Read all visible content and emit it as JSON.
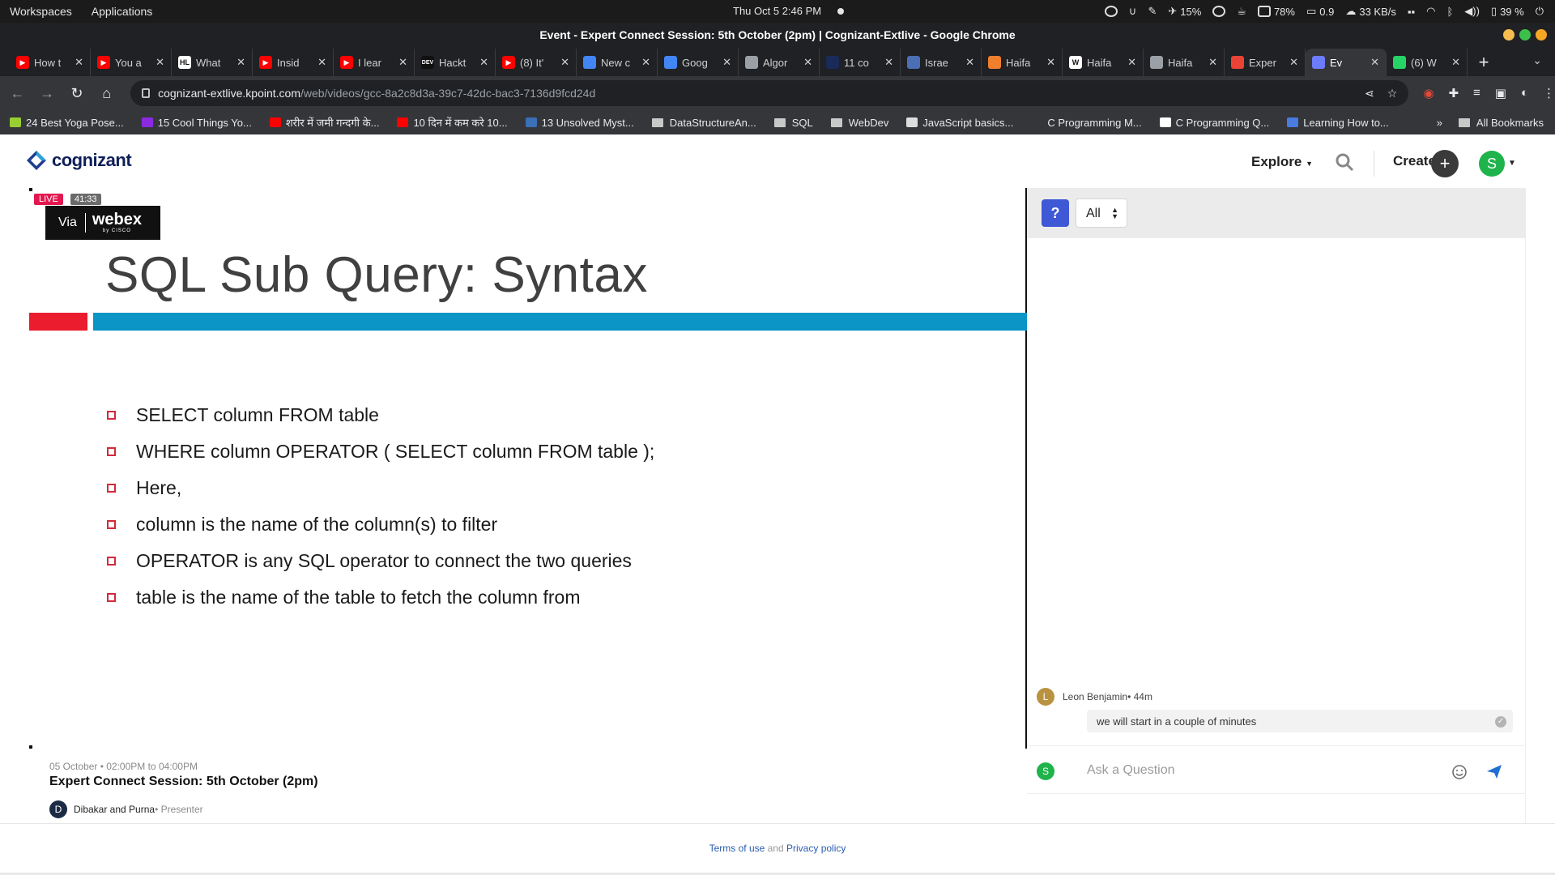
{
  "os": {
    "menus": [
      "Workspaces",
      "Applications"
    ],
    "clock": "Thu Oct 5   2:46 PM",
    "tray": {
      "fan": "15%",
      "battery_pct_label": "78%",
      "load": "0.9",
      "net": "33 KB/s",
      "power": "39 %"
    }
  },
  "window": {
    "title": "Event - Expert Connect Session: 5th October (2pm) | Cognizant-Extlive - Google Chrome"
  },
  "tabs": [
    {
      "label": "How t",
      "fav": "youtube",
      "color": "#ff0000"
    },
    {
      "label": "You a",
      "fav": "youtube",
      "color": "#ff0000"
    },
    {
      "label": "What",
      "fav": "HL",
      "color": "#ffffff"
    },
    {
      "label": "Insid",
      "fav": "youtube",
      "color": "#ff0000"
    },
    {
      "label": "I lear",
      "fav": "youtube",
      "color": "#ff0000"
    },
    {
      "label": "Hackt",
      "fav": "DEV",
      "color": "#111111"
    },
    {
      "label": "(8) It'",
      "fav": "youtube",
      "color": "#ff0000"
    },
    {
      "label": "New c",
      "fav": "gcloud",
      "color": "#4285f4"
    },
    {
      "label": "Goog",
      "fav": "gcloud",
      "color": "#4285f4"
    },
    {
      "label": "Algor",
      "fav": "globe",
      "color": "#9aa0a6"
    },
    {
      "label": "11 co",
      "fav": "R",
      "color": "#1a2a5a"
    },
    {
      "label": "Israe",
      "fav": "wiki",
      "color": "#4a6fb5"
    },
    {
      "label": "Haifa",
      "fav": "doc",
      "color": "#f07f2d"
    },
    {
      "label": "Haifa",
      "fav": "W",
      "color": "#ffffff"
    },
    {
      "label": "Haifa",
      "fav": "globe",
      "color": "#9aa0a6"
    },
    {
      "label": "Exper",
      "fav": "gmail",
      "color": "#ea4335"
    },
    {
      "label": "Ev",
      "fav": "kpoint",
      "color": "#6b7cff",
      "active": true
    },
    {
      "label": "(6) W",
      "fav": "whatsapp",
      "color": "#25d366"
    }
  ],
  "toolbar": {
    "url_host": "cognizant-extlive.kpoint.com",
    "url_path": "/web/videos/gcc-8a2c8d3a-39c7-42dc-bac3-7136d9fcd24d"
  },
  "bookmarks": [
    {
      "label": "24 Best Yoga Pose...",
      "color": "#9acd32"
    },
    {
      "label": "15 Cool Things Yo...",
      "color": "#8a2be2"
    },
    {
      "label": "शरीर में जमी गन्दगी के...",
      "color": "#ff0000"
    },
    {
      "label": "10 दिन में कम करे 10...",
      "color": "#ff0000"
    },
    {
      "label": "13 Unsolved Myst...",
      "color": "#3b6fb6"
    },
    {
      "label": "DataStructureAn...",
      "color": "folder"
    },
    {
      "label": "SQL",
      "color": "folder"
    },
    {
      "label": "WebDev",
      "color": "folder"
    },
    {
      "label": "JavaScript basics...",
      "color": "#dddddd"
    },
    {
      "label": "C Programming M...",
      "color": "#35363a"
    },
    {
      "label": "C Programming Q...",
      "color": "#ffffff"
    },
    {
      "label": "Learning How to...",
      "color": "#4a7be0"
    }
  ],
  "bookmarks_right": {
    "more": "»",
    "all": "All Bookmarks"
  },
  "site": {
    "logo_text": "cognizant",
    "explore": "Explore",
    "create": "Create",
    "create_plus": "+",
    "avatar_letter": "S"
  },
  "video": {
    "live": "LIVE",
    "elapsed": "41:33",
    "via": "Via",
    "webex": "webex",
    "cisco": "by CISCO",
    "slide_title": "SQL Sub Query: Syntax",
    "bullets": [
      "SELECT column FROM  table",
      "WHERE  column OPERATOR (  SELECT column FROM table );",
      "Here,",
      "column is the name of the column(s) to filter",
      "OPERATOR is any SQL operator to connect the two queries",
      "table is the name of the table to fetch the column from"
    ]
  },
  "event": {
    "date": "05 October • 02:00PM to 04:00PM",
    "title": "Expert Connect Session: 5th October (2pm)",
    "presenter_initial": "D",
    "presenter": "Dibakar and Purna",
    "presenter_role": " • Presenter"
  },
  "chat": {
    "question_icon": "?",
    "filter": "All",
    "message": {
      "initial": "L",
      "author": "Leon Benjamin",
      "time": " • 44m",
      "text": "we will start in a couple of minutes"
    },
    "ask_initial": "S",
    "ask_placeholder": "Ask a Question"
  },
  "footer": {
    "terms": "Terms of use",
    "and": " and ",
    "privacy": "Privacy policy"
  }
}
